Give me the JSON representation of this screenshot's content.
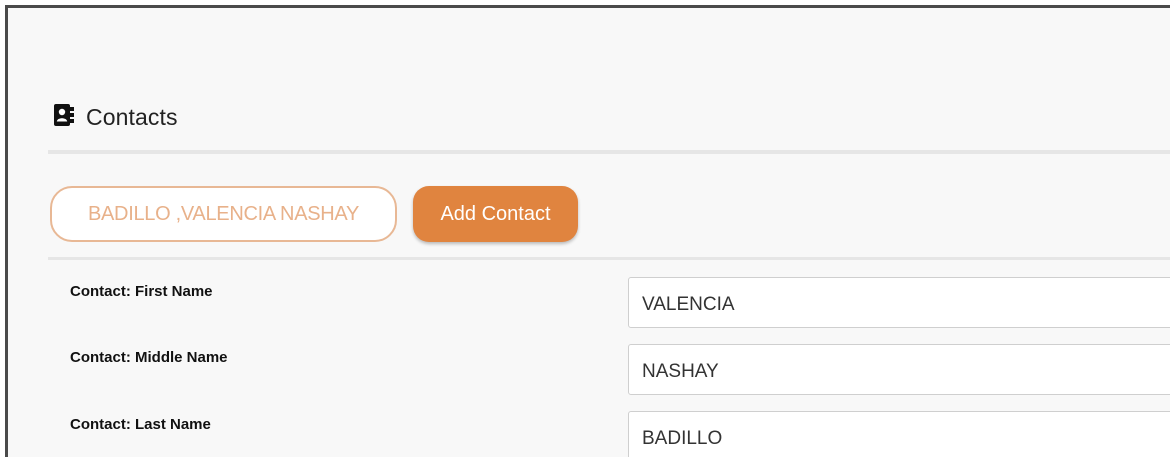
{
  "section": {
    "title": "Contacts",
    "icon": "contact-book-icon"
  },
  "contact_pill_label": "BADILLO ,VALENCIA NASHAY",
  "add_contact_label": "Add Contact",
  "fields": [
    {
      "label": "Contact: First Name",
      "value": "VALENCIA"
    },
    {
      "label": "Contact: Middle Name",
      "value": "NASHAY"
    },
    {
      "label": "Contact: Last Name",
      "value": "BADILLO"
    }
  ],
  "colors": {
    "accent": "#e0843f",
    "pill_border": "#e8b895",
    "pill_text": "#e8b18a"
  }
}
